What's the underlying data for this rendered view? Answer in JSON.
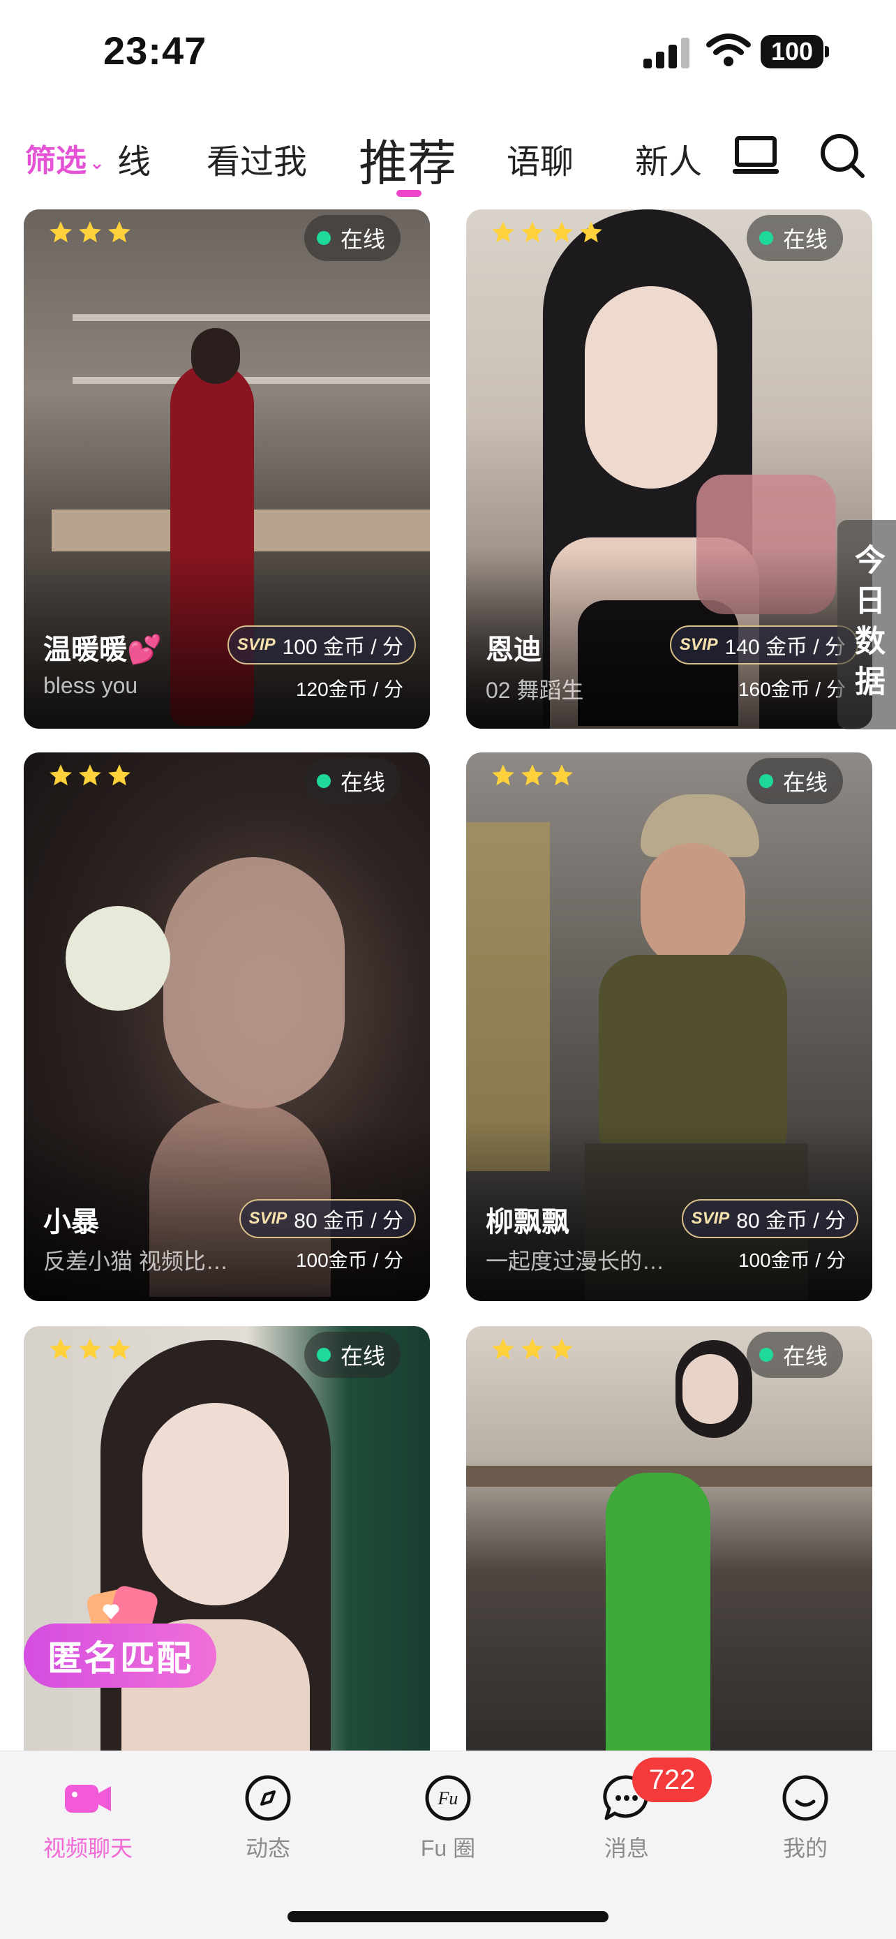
{
  "status_bar": {
    "time": "23:47",
    "battery": "100"
  },
  "top_nav": {
    "filter": "筛选",
    "tabs": [
      {
        "label": "线"
      },
      {
        "label": "看过我"
      },
      {
        "label": "推荐"
      },
      {
        "label": "语聊"
      },
      {
        "label": "新人"
      }
    ],
    "icons": [
      "laptop-icon",
      "search-icon"
    ]
  },
  "side_tab": {
    "label": "今日数据"
  },
  "cards": [
    {
      "stars": 3,
      "status": "在线",
      "name": "温暖暖💕",
      "subtitle": "bless you",
      "svip_label": "SVIP",
      "svip_price": "100 金币 / 分",
      "price": "120金币 / 分"
    },
    {
      "stars": 4,
      "status": "在线",
      "name": "恩迪",
      "subtitle": "02 舞蹈生",
      "svip_label": "SVIP",
      "svip_price": "140 金币 / 分",
      "price": "160金币 / 分"
    },
    {
      "stars": 3,
      "status": "在线",
      "name": "小暴",
      "subtitle": "反差小猫 视频比…",
      "svip_label": "SVIP",
      "svip_price": "80 金币 / 分",
      "price": "100金币 / 分"
    },
    {
      "stars": 3,
      "status": "在线",
      "name": "柳飘飘",
      "subtitle": "一起度过漫长的…",
      "svip_label": "SVIP",
      "svip_price": "80 金币 / 分",
      "price": "100金币 / 分"
    },
    {
      "stars": 3,
      "status": "在线"
    },
    {
      "stars": 3,
      "status": "在线"
    }
  ],
  "anon_match": {
    "label": "匿名匹配"
  },
  "tab_bar": {
    "items": [
      {
        "label": "视频聊天",
        "icon": "video-camera-icon"
      },
      {
        "label": "动态",
        "icon": "compass-icon"
      },
      {
        "label": "Fu 圈",
        "icon": "fu-circle-icon"
      },
      {
        "label": "消息",
        "icon": "chat-bubble-icon",
        "badge": "722"
      },
      {
        "label": "我的",
        "icon": "smile-icon"
      }
    ]
  },
  "colors": {
    "accent": "#ee46c9",
    "online": "#1fd99a",
    "badge": "#f43a3a"
  }
}
